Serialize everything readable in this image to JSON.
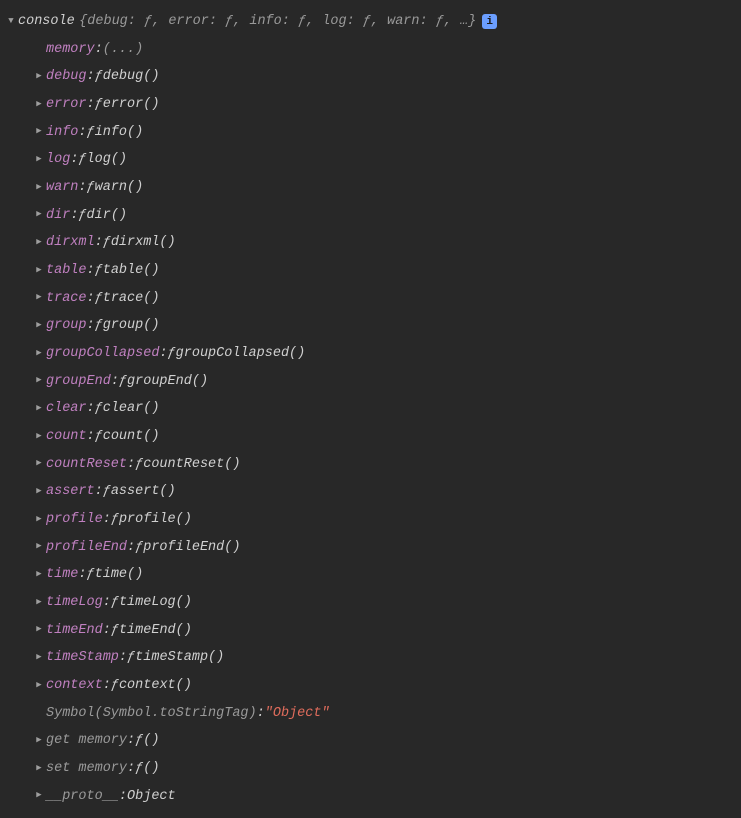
{
  "header": {
    "object_name": "console",
    "brace_open": "{",
    "summary_pairs": [
      {
        "k": "debug",
        "v": "ƒ"
      },
      {
        "k": "error",
        "v": "ƒ"
      },
      {
        "k": "info",
        "v": "ƒ"
      },
      {
        "k": "log",
        "v": "ƒ"
      },
      {
        "k": "warn",
        "v": "ƒ"
      }
    ],
    "summary_ellipsis": "…",
    "brace_close": "}",
    "info_badge": "i"
  },
  "rows": [
    {
      "tri": "none",
      "key": "memory",
      "key_cls": "key-purple",
      "kind": "plain",
      "val": "(...)",
      "val_cls": "val-gray"
    },
    {
      "tri": "right",
      "key": "debug",
      "key_cls": "key-purple",
      "kind": "fn",
      "fn": "debug()"
    },
    {
      "tri": "right",
      "key": "error",
      "key_cls": "key-purple",
      "kind": "fn",
      "fn": "error()"
    },
    {
      "tri": "right",
      "key": "info",
      "key_cls": "key-purple",
      "kind": "fn",
      "fn": "info()"
    },
    {
      "tri": "right",
      "key": "log",
      "key_cls": "key-purple",
      "kind": "fn",
      "fn": "log()"
    },
    {
      "tri": "right",
      "key": "warn",
      "key_cls": "key-purple",
      "kind": "fn",
      "fn": "warn()"
    },
    {
      "tri": "right",
      "key": "dir",
      "key_cls": "key-purple",
      "kind": "fn",
      "fn": "dir()"
    },
    {
      "tri": "right",
      "key": "dirxml",
      "key_cls": "key-purple",
      "kind": "fn",
      "fn": "dirxml()"
    },
    {
      "tri": "right",
      "key": "table",
      "key_cls": "key-purple",
      "kind": "fn",
      "fn": "table()"
    },
    {
      "tri": "right",
      "key": "trace",
      "key_cls": "key-purple",
      "kind": "fn",
      "fn": "trace()"
    },
    {
      "tri": "right",
      "key": "group",
      "key_cls": "key-purple",
      "kind": "fn",
      "fn": "group()"
    },
    {
      "tri": "right",
      "key": "groupCollapsed",
      "key_cls": "key-purple",
      "kind": "fn",
      "fn": "groupCollapsed()"
    },
    {
      "tri": "right",
      "key": "groupEnd",
      "key_cls": "key-purple",
      "kind": "fn",
      "fn": "groupEnd()"
    },
    {
      "tri": "right",
      "key": "clear",
      "key_cls": "key-purple",
      "kind": "fn",
      "fn": "clear()"
    },
    {
      "tri": "right",
      "key": "count",
      "key_cls": "key-purple",
      "kind": "fn",
      "fn": "count()"
    },
    {
      "tri": "right",
      "key": "countReset",
      "key_cls": "key-purple",
      "kind": "fn",
      "fn": "countReset()"
    },
    {
      "tri": "right",
      "key": "assert",
      "key_cls": "key-purple",
      "kind": "fn",
      "fn": "assert()"
    },
    {
      "tri": "right",
      "key": "profile",
      "key_cls": "key-purple",
      "kind": "fn",
      "fn": "profile()"
    },
    {
      "tri": "right",
      "key": "profileEnd",
      "key_cls": "key-purple",
      "kind": "fn",
      "fn": "profileEnd()"
    },
    {
      "tri": "right",
      "key": "time",
      "key_cls": "key-purple",
      "kind": "fn",
      "fn": "time()"
    },
    {
      "tri": "right",
      "key": "timeLog",
      "key_cls": "key-purple",
      "kind": "fn",
      "fn": "timeLog()"
    },
    {
      "tri": "right",
      "key": "timeEnd",
      "key_cls": "key-purple",
      "kind": "fn",
      "fn": "timeEnd()"
    },
    {
      "tri": "right",
      "key": "timeStamp",
      "key_cls": "key-purple",
      "kind": "fn",
      "fn": "timeStamp()"
    },
    {
      "tri": "right",
      "key": "context",
      "key_cls": "key-purple",
      "kind": "fn",
      "fn": "context()"
    },
    {
      "tri": "none",
      "key": "Symbol(Symbol.toStringTag)",
      "key_cls": "key-gray",
      "kind": "str",
      "str": "\"Object\""
    },
    {
      "tri": "right",
      "key": "get memory",
      "key_cls": "key-gray",
      "kind": "fn",
      "fn": "()"
    },
    {
      "tri": "right",
      "key": "set memory",
      "key_cls": "key-gray",
      "kind": "fn",
      "fn": "()"
    },
    {
      "tri": "right",
      "key": "__proto__",
      "key_cls": "key-gray",
      "kind": "plain",
      "val": "Object",
      "val_cls": "val-text"
    }
  ],
  "glyphs": {
    "f": "ƒ"
  }
}
